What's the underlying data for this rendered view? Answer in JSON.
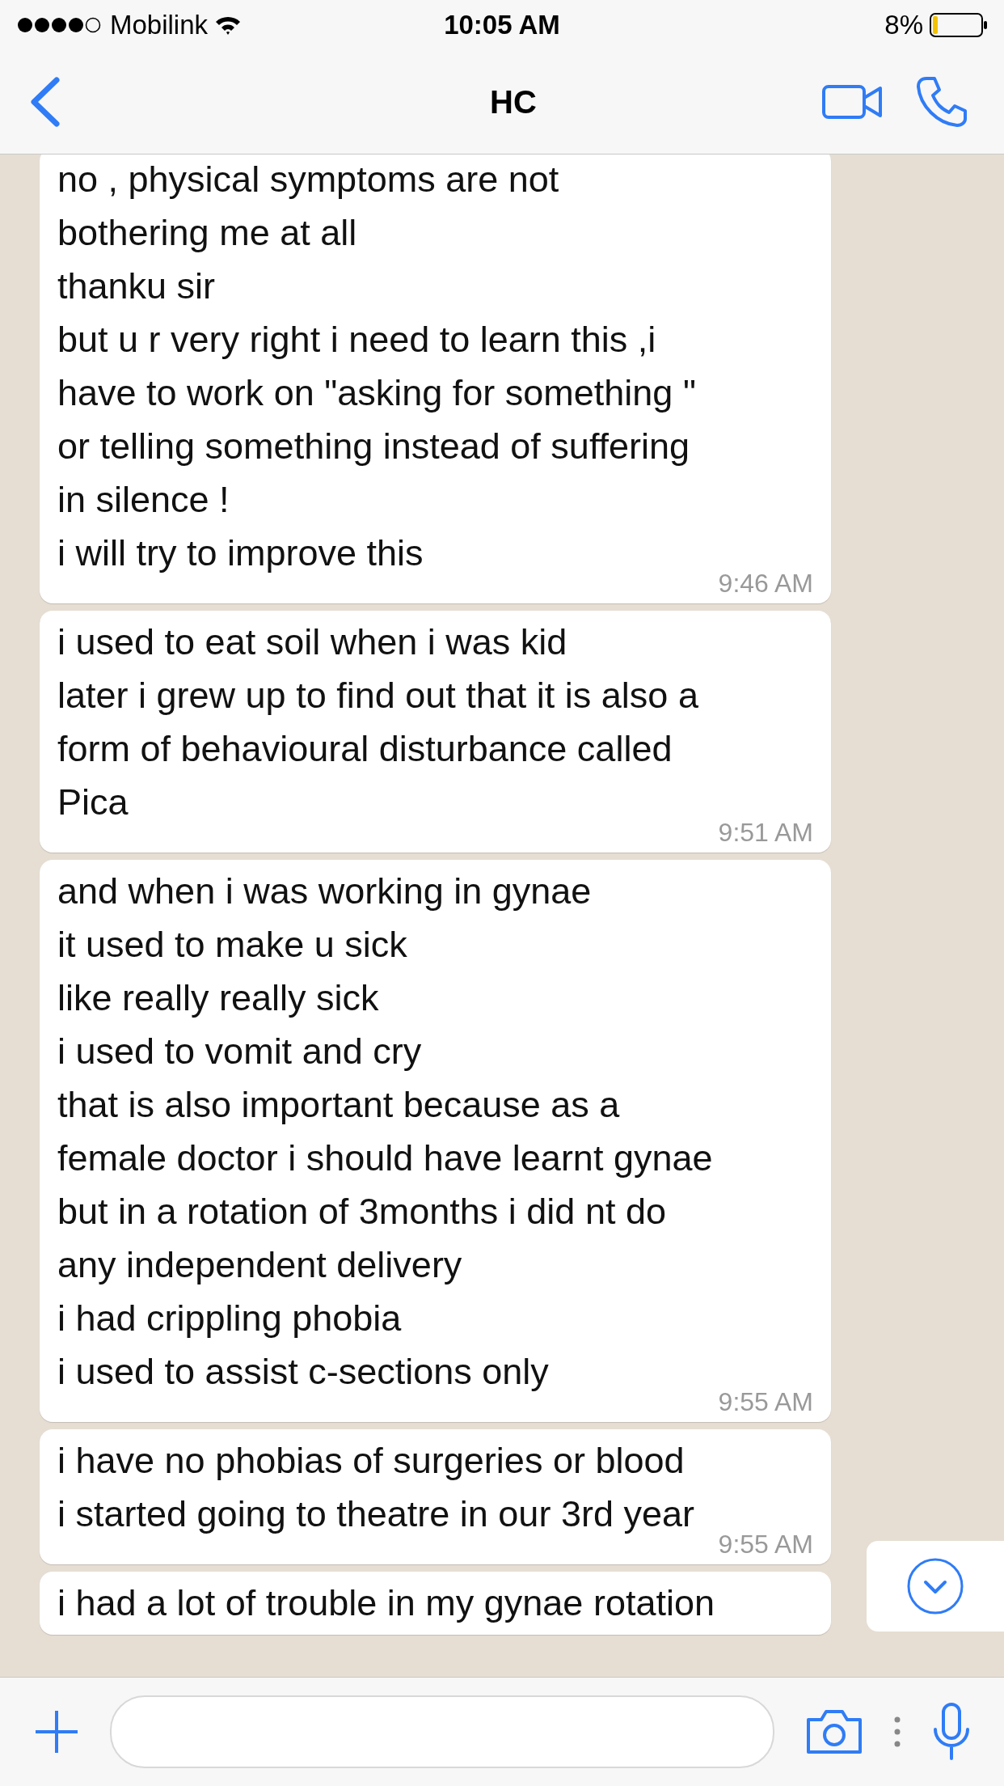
{
  "status_bar": {
    "carrier": "Mobilink",
    "time": "10:05 AM",
    "battery": "8%"
  },
  "header": {
    "title": "HC"
  },
  "messages": [
    {
      "lines": [
        "no , physical symptoms are not",
        "bothering me at all",
        "thanku sir",
        "but u r very right i need to learn this ,i",
        "have to work on \"asking for something \"",
        "or telling something instead of suffering",
        "in silence !",
        "i will try to improve this"
      ],
      "time": "9:46 AM"
    },
    {
      "lines": [
        "i used to eat soil when i was kid",
        "later i grew up to find out that it is also a",
        "form of behavioural disturbance called",
        "Pica"
      ],
      "time": "9:51 AM"
    },
    {
      "lines": [
        "and when i was working in gynae",
        "it used to make u sick",
        "like really really sick",
        "i used to vomit and cry",
        "that is also important because as a",
        "female doctor i should have learnt gynae",
        "but in a rotation of 3months i did nt do",
        "any independent delivery",
        "i had crippling phobia",
        "i used to assist c-sections only"
      ],
      "time": "9:55 AM"
    },
    {
      "lines": [
        "i have no phobias of surgeries or blood",
        "i started going to theatre in our 3rd year"
      ],
      "time": "9:55 AM"
    },
    {
      "lines": [
        "i had a lot of trouble in my gynae rotation"
      ]
    }
  ]
}
